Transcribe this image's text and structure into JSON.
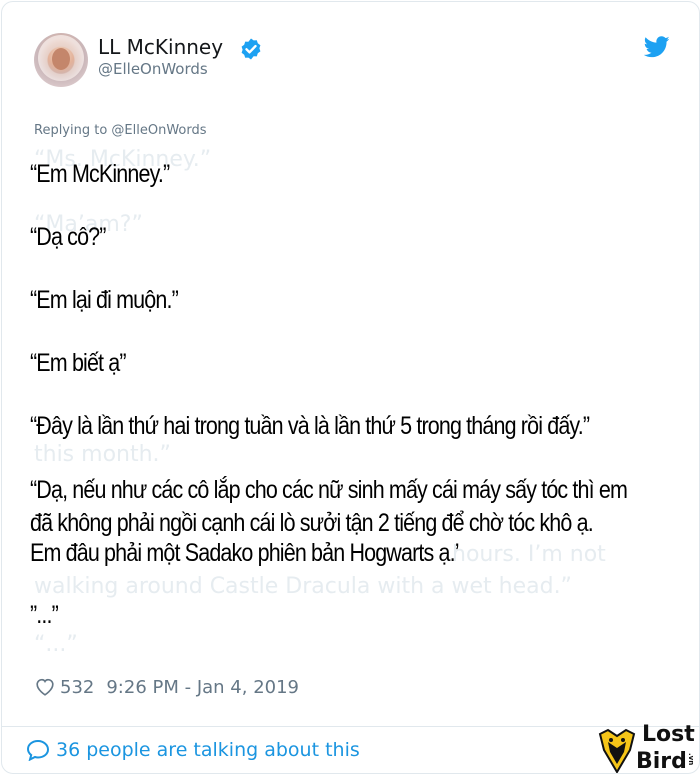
{
  "user": {
    "name": "LL McKinney",
    "handle": "@ElleOnWords",
    "verified": true
  },
  "tweet": {
    "replying_to": "Replying to @ElleOnWords",
    "lines": [
      "“Em McKinney.”",
      "“Dạ cô?”",
      "“Em lại đi muộn.”",
      "“Em biết ạ”",
      "“Đây là lần thứ hai trong tuần và là lần thứ 5 trong tháng rồi đấy.”",
      "“Dạ, nếu như các cô lắp cho các nữ sinh mấy cái máy sấy tóc thì em",
      "đã không phải ngồi cạnh cái lò sưởi tận 2 tiếng để chờ tóc khô ạ.",
      "Em đâu phải một Sadako phiên bản Hogwarts ạ.’",
      "”...”"
    ],
    "ghost_text": [
      "“Ms. McKinney.”",
      "“Ma’am?”",
      "this month.”",
      "hours. I’m not",
      "walking around Castle Dracula with a wet head.”",
      "“...”"
    ],
    "likes": "532",
    "timestamp": "9:26 PM - Jan 4, 2019"
  },
  "footer": {
    "talk_text": "36 people are talking about this"
  },
  "watermark": {
    "line1": "Lost",
    "line2": "Bird",
    "tag": ".vn"
  },
  "colors": {
    "accent": "#1b95e0",
    "twitter_blue": "#1da1f2",
    "muted": "#657786"
  }
}
